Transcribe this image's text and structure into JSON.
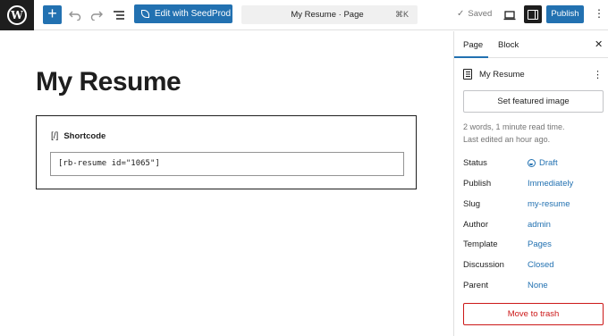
{
  "topbar": {
    "logo_letter": "W",
    "add_icon": "plus-icon",
    "seedprod_label": "Edit with SeedProd",
    "command_title": "My Resume · Page",
    "command_shortcut": "⌘K",
    "saved_label": "Saved",
    "publish_label": "Publish"
  },
  "editor": {
    "page_title": "My Resume",
    "block_label": "Shortcode",
    "block_icon_glyph": "[/]",
    "shortcode_value": "[rb-resume id=\"1065\"]"
  },
  "sidebar": {
    "tabs": [
      {
        "label": "Page"
      },
      {
        "label": "Block"
      }
    ],
    "doc_title": "My Resume",
    "featured_label": "Set featured image",
    "meta_words": "2 words, 1 minute read time.",
    "meta_edited": "Last edited an hour ago.",
    "rows": [
      {
        "label": "Status",
        "value": "Draft"
      },
      {
        "label": "Publish",
        "value": "Immediately"
      },
      {
        "label": "Slug",
        "value": "my-resume"
      },
      {
        "label": "Author",
        "value": "admin"
      },
      {
        "label": "Template",
        "value": "Pages"
      },
      {
        "label": "Discussion",
        "value": "Closed"
      },
      {
        "label": "Parent",
        "value": "None"
      }
    ],
    "trash_label": "Move to trash"
  },
  "colors": {
    "accent": "#2271b1",
    "dark": "#1e1e1e",
    "danger": "#cc1818"
  }
}
